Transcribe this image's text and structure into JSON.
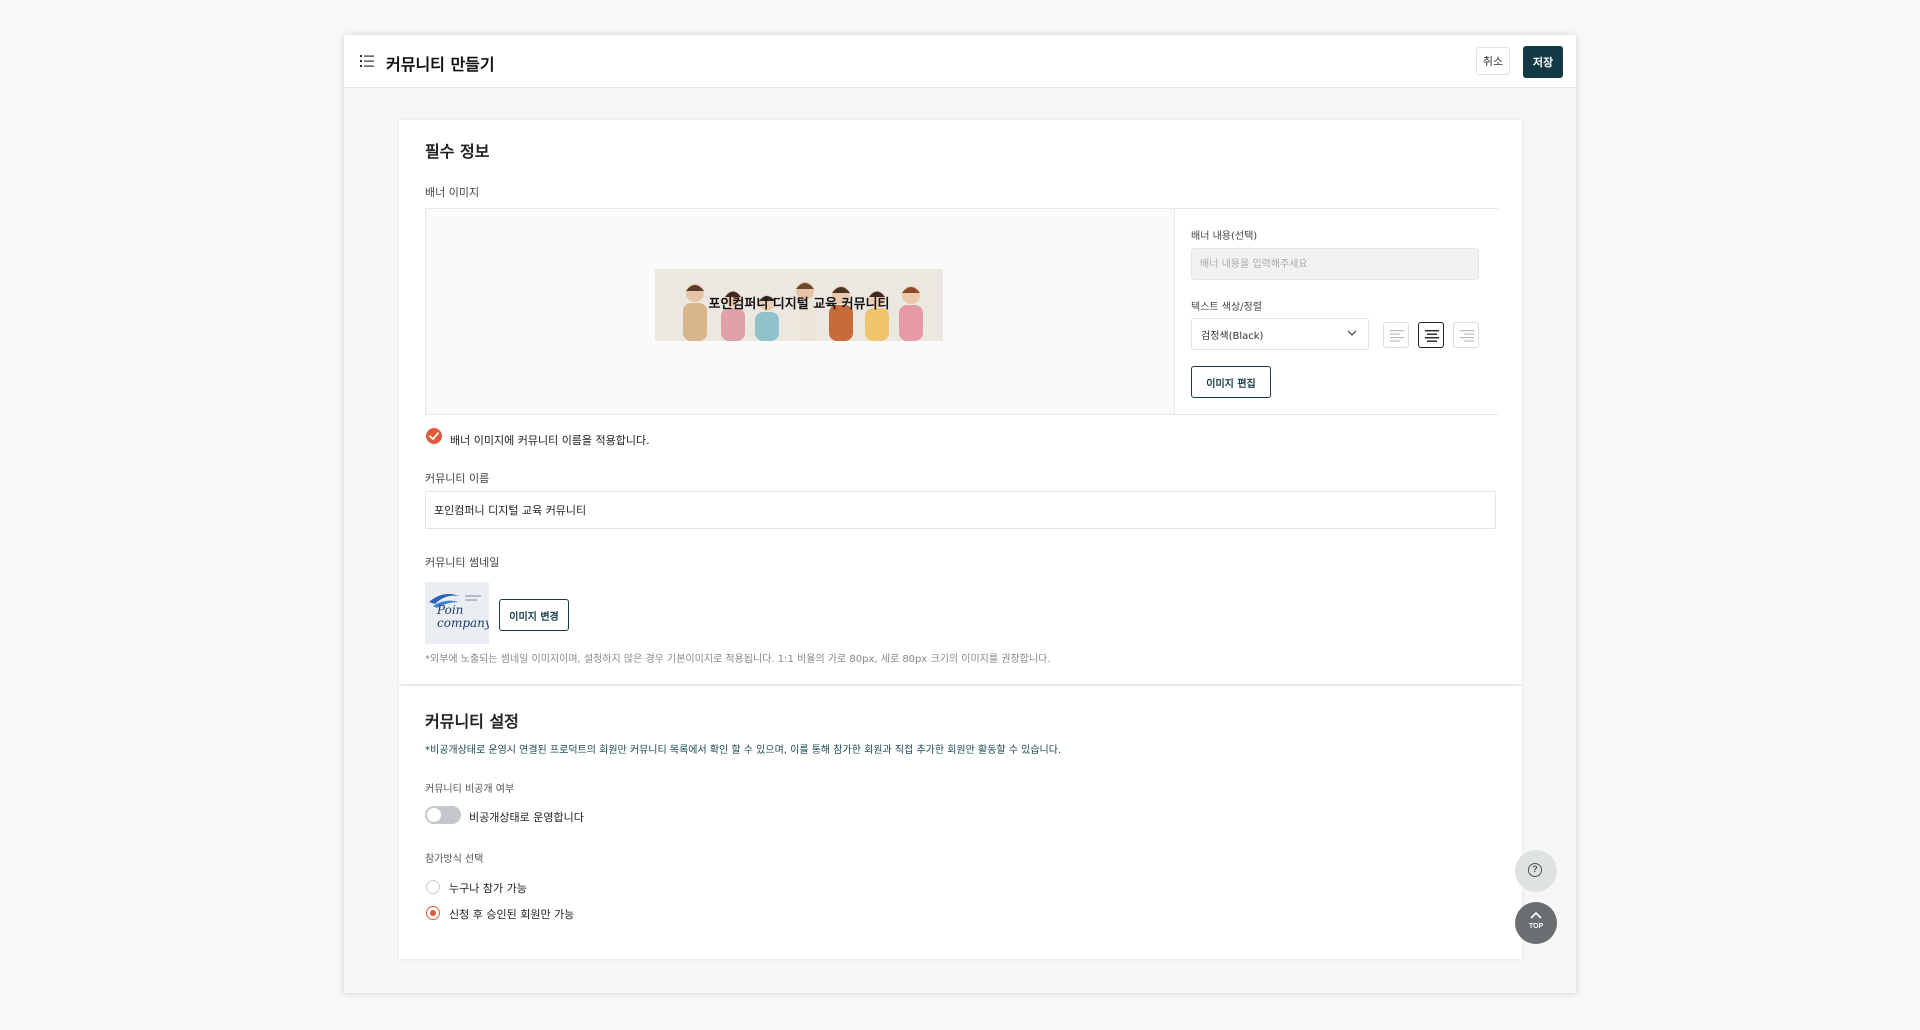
{
  "header": {
    "title": "커뮤니티 만들기",
    "cancel_label": "취소",
    "save_label": "저장"
  },
  "required_info": {
    "title": "필수 정보",
    "banner_label": "배너 이미지",
    "banner_text": "포인컴퍼니 디지털 교육 커뮤니티",
    "banner_content_label": "배너 내용(선택)",
    "banner_content_placeholder": "배너 내용을 입력해주세요",
    "text_color_label": "텍스트 색상/정렬",
    "text_color_value": "검정색(Black)",
    "text_align_selected": "center",
    "edit_image_label": "이미지 편집",
    "apply_name_label": "배너 이미지에 커뮤니티 이름을 적용합니다.",
    "apply_name_checked": true,
    "name_label": "커뮤니티 이름",
    "name_value": "포인컴퍼니 디지털 교육 커뮤니티",
    "thumbnail_label": "커뮤니티 썸네일",
    "thumbnail_logo_text": "Poin company",
    "change_image_label": "이미지 변경",
    "helper_text": "*외부에 노출되는 썸네일 이미지이며, 설정하지 않은 경우 기본이미지로 적용됩니다. 1:1 비율의 가로 80px, 세로 80px 크기의 이미지를 권장합니다."
  },
  "settings": {
    "title": "커뮤니티 설정",
    "notice": "*비공개상태로 운영시 연결된 프로덕트의 회원만 커뮤니티 목록에서 확인 할 수 있으며, 이를 통해 참가한 회원과 직접 추가한 회원만 활동할 수 있습니다.",
    "private_label": "커뮤니티 비공개 여부",
    "private_toggle_label": "비공개상태로 운영합니다",
    "private_enabled": false,
    "join_label": "참가방식 선택",
    "join_options": [
      {
        "label": "누구나 참가 가능",
        "checked": false
      },
      {
        "label": "신청 후 승인된 회원만 가능",
        "checked": true
      }
    ]
  },
  "fab": {
    "top_label": "TOP"
  },
  "colors": {
    "primary": "#123a44",
    "accent": "#e25a3c",
    "toggle_off": "#c4c7cb"
  }
}
